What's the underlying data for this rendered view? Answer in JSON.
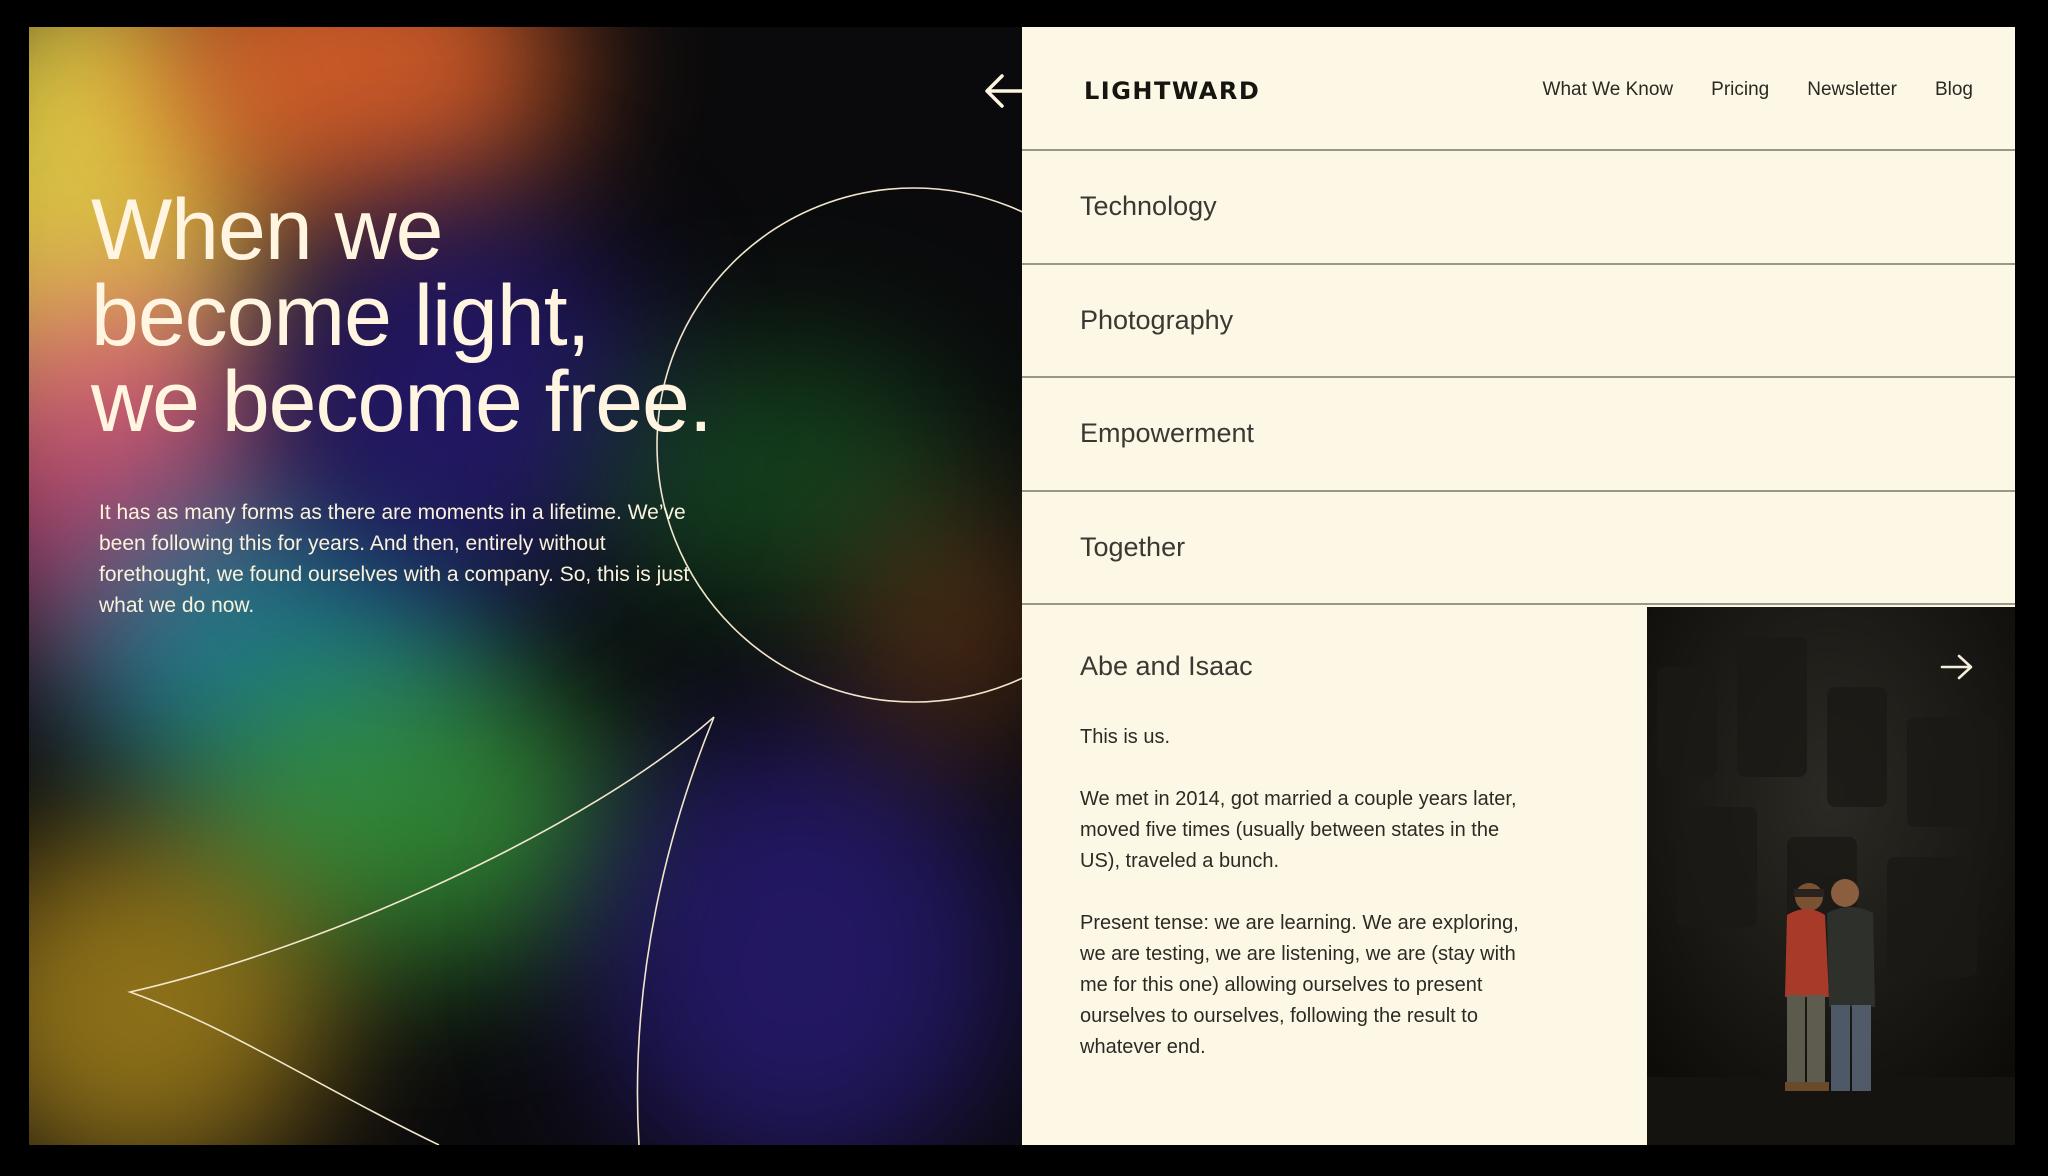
{
  "hero": {
    "title_lines": [
      "When we",
      "become light,",
      "we become free."
    ],
    "body": "It has as many forms as there are moments in a lifetime. We’ve been following this for years. And then, entirely without forethought, we found ourselves with a company. So, this is just what we do now."
  },
  "header": {
    "logo": "LIGHTWARD",
    "nav": [
      "What We Know",
      "Pricing",
      "Newsletter",
      "Blog"
    ]
  },
  "topics": [
    "Technology",
    "Photography",
    "Empowerment",
    "Together"
  ],
  "story": {
    "title": "Abe and Isaac",
    "paragraphs": [
      "This is us.",
      "We met in 2014, got married a couple years later, moved five times (usually between states in the US), traveled a bunch.",
      "Present tense: we are learning. We are exploring, we are testing, we are listening, we are (stay with me for this one) allowing ourselves to present ourselves to ourselves, following the result to whatever end."
    ]
  },
  "colors": {
    "panel_background": "#fdf8e6",
    "divider": "#9a9688",
    "hero_text": "#fff5e0"
  },
  "icons": [
    "back-arrow-icon",
    "forward-arrow-icon"
  ]
}
